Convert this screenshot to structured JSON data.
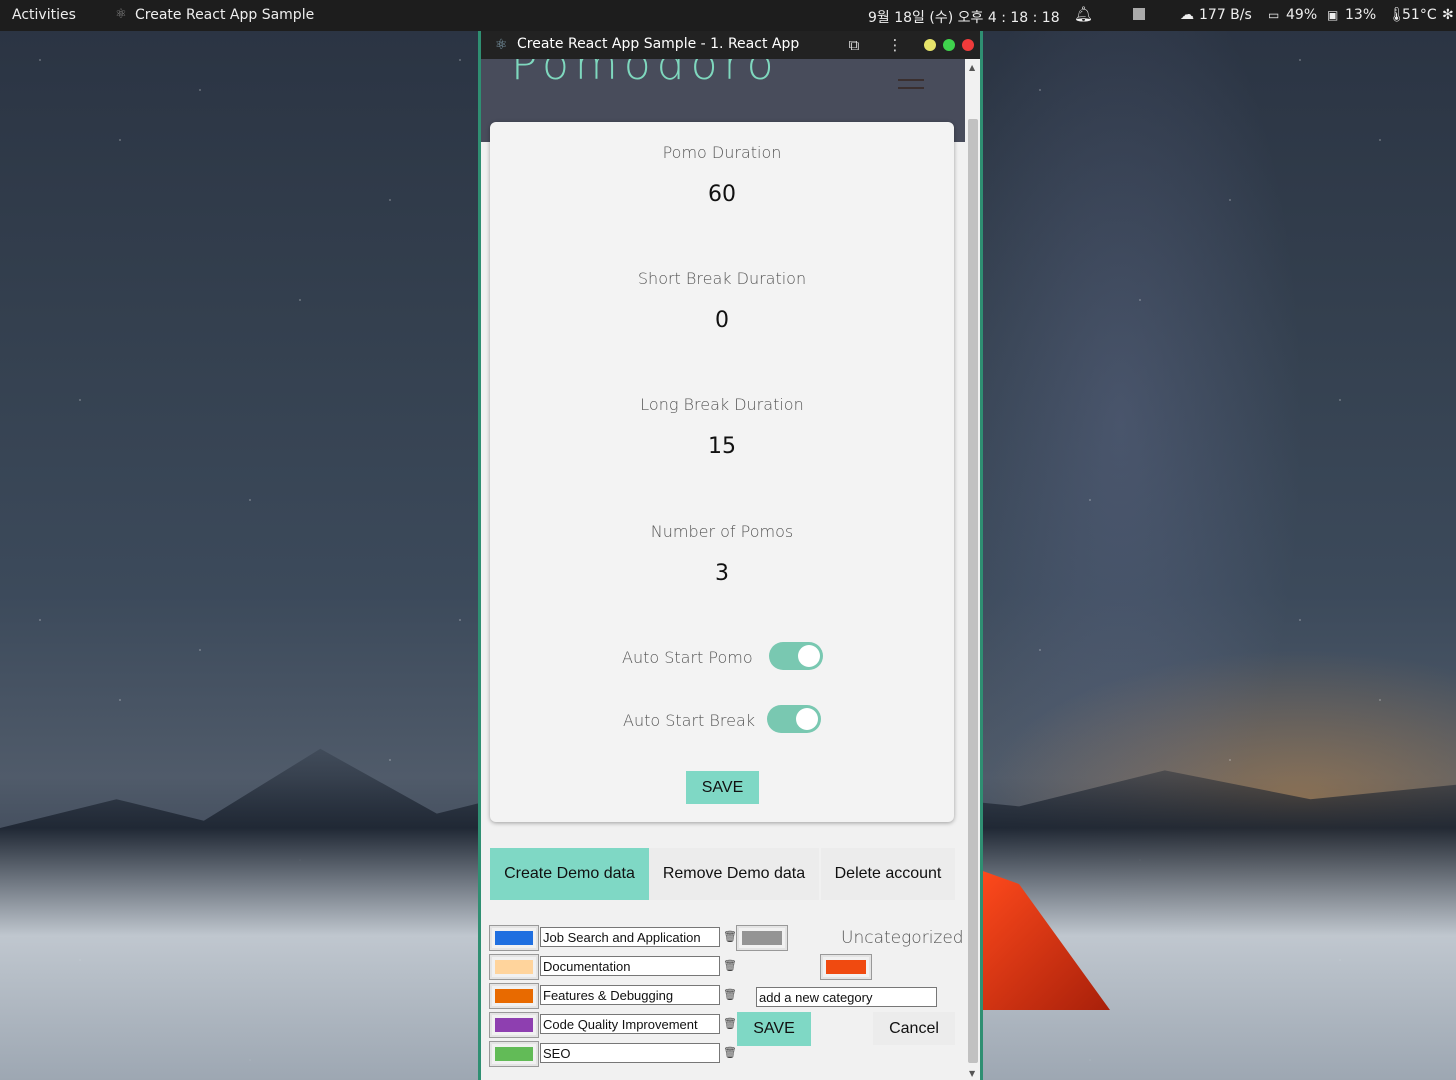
{
  "topbar": {
    "activities": "Activities",
    "app_name": "Create React App Sample",
    "datetime": "9월 18일 (수) 오후 4 : 18 : 18",
    "net_speed": "177 B/s",
    "battery": "49%",
    "disk": "13%",
    "temperature": "51°C"
  },
  "window": {
    "title": "Create React App Sample - 1. React App"
  },
  "app": {
    "logo": "Pomodoro"
  },
  "settings": {
    "pomo_label": "Pomo Duration",
    "pomo_value": "60",
    "short_label": "Short Break Duration",
    "short_value": "0",
    "long_label": "Long Break Duration",
    "long_value": "15",
    "count_label": "Number of Pomos",
    "count_value": "3",
    "auto_pomo_label": "Auto Start Pomo",
    "auto_pomo_on": true,
    "auto_break_label": "Auto Start Break",
    "auto_break_on": true,
    "save_label": "SAVE"
  },
  "tabs": [
    {
      "label": "Create Demo data"
    },
    {
      "label": "Remove Demo data"
    },
    {
      "label": "Delete account"
    }
  ],
  "categories": [
    {
      "name": "Job Search and Application",
      "color": "#1f6fe0"
    },
    {
      "name": "Documentation",
      "color": "#ffd49c"
    },
    {
      "name": "Features & Debugging",
      "color": "#e86a00"
    },
    {
      "name": "Code Quality Improvement",
      "color": "#8e3fb0"
    },
    {
      "name": "SEO",
      "color": "#62bb57"
    }
  ],
  "category_editor": {
    "uncategorized_label": "Uncategorized",
    "uncategorized_color": "#949494",
    "new_color": "#f04a10",
    "new_category_value": "add a new category",
    "save_label": "SAVE",
    "cancel_label": "Cancel"
  }
}
